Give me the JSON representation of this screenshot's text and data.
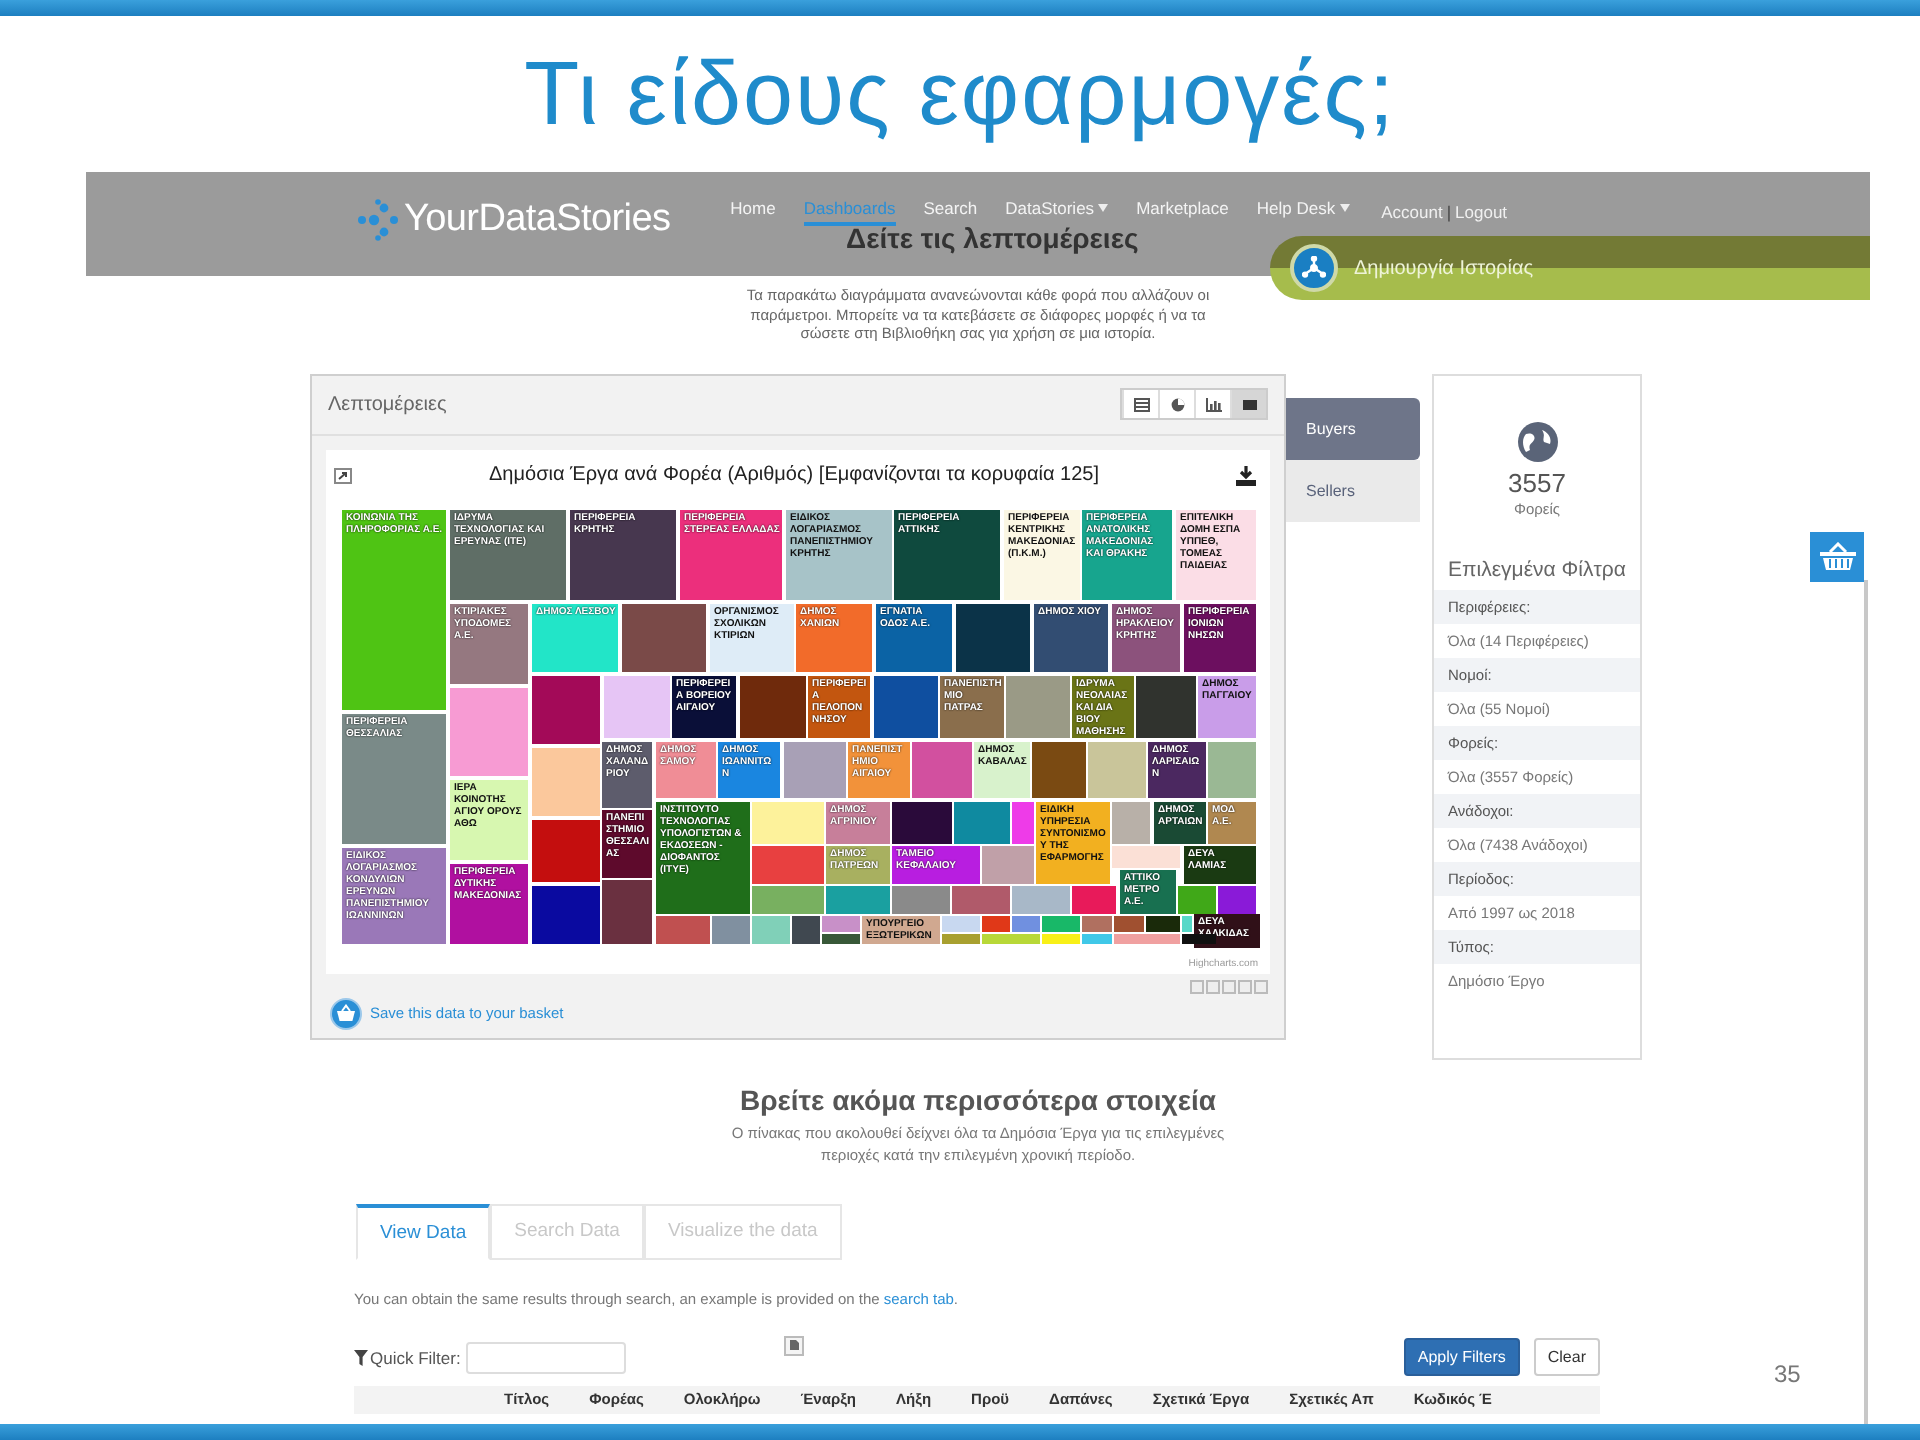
{
  "slide": {
    "title": "Τι είδους εφαρμογές;",
    "page_number": "35"
  },
  "navbar": {
    "logo": "YourDataStories",
    "items": [
      {
        "label": "Home",
        "selected": false,
        "dropdown": false
      },
      {
        "label": "Dashboards",
        "selected": true,
        "dropdown": false
      },
      {
        "label": "Search",
        "selected": false,
        "dropdown": false
      },
      {
        "label": "DataStories",
        "selected": false,
        "dropdown": true
      },
      {
        "label": "Marketplace",
        "selected": false,
        "dropdown": false
      },
      {
        "label": "Help Desk",
        "selected": false,
        "dropdown": true
      }
    ],
    "account": "Account",
    "separator": "|",
    "logout": "Logout"
  },
  "page_heading": "Δείτε τις λεπτομέρειες",
  "create_story_button": "Δημιουργία Ιστορίας",
  "intro": "Τα παρακάτω διαγράμματα ανανεώνονται κάθε φορά που αλλάζουν οι παράμετροι. Μπορείτε να τα κατεβάσετε σε διάφορες μορφές ή να τα σώσετε στη Βιβλιοθήκη σας για χρήση σε μια ιστορία.",
  "details_panel": {
    "title": "Λεπτομέρειες",
    "views": [
      {
        "kind": "table",
        "selected": false
      },
      {
        "kind": "pie",
        "selected": false
      },
      {
        "kind": "bar",
        "selected": false
      },
      {
        "kind": "treemap",
        "selected": true
      }
    ],
    "chart_title": "Δημόσια Έργα ανά Φορέα (Αριθμός) [Εμφανίζονται τα κορυφαία 125]",
    "treemap": {
      "cells": [
        {
          "label": "ΚΟΙΝΩΝΙΑ ΤΗΣ ΠΛΗΡΟΦΟΡΙΑΣ Α.Ε.",
          "color": "#4fc414"
        },
        {
          "label": "ΙΔΡΥΜΑ ΤΕΧΝΟΛΟΓΙΑΣ ΚΑΙ ΕΡΕΥΝΑΣ (ΙΤΕ)",
          "color": "#5f6e66"
        },
        {
          "label": "ΠΕΡΙΦΕΡΕΙΑ ΚΡΗΤΗΣ",
          "color": "#47374f"
        },
        {
          "label": "ΠΕΡΙΦΕΡΕΙΑ ΣΤΕΡΕΑΣ ΕΛΛΑΔΑΣ",
          "color": "#ec2f7c"
        },
        {
          "label": "ΕΙΔΙΚΟΣ ΛΟΓΑΡΙΑΣΜΟΣ ΠΑΝΕΠΙΣΤΗΜΙΟΥ ΚΡΗΤΗΣ",
          "color": "#a7c3c8"
        },
        {
          "label": "ΠΕΡΙΦΕΡΕΙΑ ΑΤΤΙΚΗΣ",
          "color": "#0f4a3e"
        },
        {
          "label": "ΠΕΡΙΦΕΡΕΙΑ ΚΕΝΤΡΙΚΗΣ ΜΑΚΕΔΟΝΙΑΣ (Π.Κ.Μ.)",
          "color": "#fbf7e4"
        },
        {
          "label": "ΠΕΡΙΦΕΡΕΙΑ ΑΝΑΤΟΛΙΚΗΣ ΜΑΚΕΔΟΝΙΑΣ ΚΑΙ ΘΡΑΚΗΣ",
          "color": "#17a58e"
        },
        {
          "label": "ΕΠΙΤΕΛΙΚΗ ΔΟΜΗ ΕΣΠΑ ΥΠΠΕΘ, ΤΟΜΕΑΣ ΠΑΙΔΕΙΑΣ",
          "color": "#fbdde6"
        },
        {
          "label": "ΚΤΙΡΙΑΚΕΣ ΥΠΟΔΟΜΕΣ Α.Ε.",
          "color": "#957880"
        },
        {
          "label": "ΔΗΜΟΣ ΛΕΣΒΟΥ",
          "color": "#22e5c8"
        },
        {
          "color": "#7a4a48"
        },
        {
          "label": "ΟΡΓΑΝΙΣΜΟΣ ΣΧΟΛΙΚΩΝ ΚΤΙΡΙΩΝ",
          "color": "#deecf7"
        },
        {
          "label": "ΔΗΜΟΣ ΧΑΝΙΩΝ",
          "color": "#f26b2a"
        },
        {
          "label": "ΕΓΝΑΤΙΑ ΟΔΟΣ Α.Ε.",
          "color": "#0b63a5"
        },
        {
          "color": "#0b3348"
        },
        {
          "label": "ΔΗΜΟΣ ΧΙΟΥ",
          "color": "#324d72"
        },
        {
          "label": "ΔΗΜΟΣ ΗΡΑΚΛΕΙΟΥ ΚΡΗΤΗΣ",
          "color": "#8c527c"
        },
        {
          "label": "ΠΕΡΙΦΕΡΕΙΑ ΙΟΝΙΩΝ ΝΗΣΩΝ",
          "color": "#6c0f5f"
        },
        {
          "color": "#a30a58"
        },
        {
          "color": "#e6c5f5"
        },
        {
          "label": "ΠΕΡΙΦΕΡΕΙΑ ΒΟΡΕΙΟΥ ΑΙΓΑΙΟΥ",
          "color": "#0a0f38"
        },
        {
          "color": "#6f2a0c"
        },
        {
          "label": "ΠΕΡΙΦΕΡΕΙΑ ΠΕΛΟΠΟΝΝΗΣΟΥ",
          "color": "#c3560f"
        },
        {
          "color": "#0f4fa0"
        },
        {
          "label": "ΠΑΝΕΠΙΣΤΗΜΙΟ ΠΑΤΡΑΣ",
          "color": "#8a6e4c"
        },
        {
          "color": "#9a9a86"
        },
        {
          "label": "ΙΔΡΥΜΑ ΝΕΟΛΑΙΑΣ ΚΑΙ ΔΙΑ ΒΙΟΥ ΜΑΘΗΣΗΣ",
          "color": "#6a7416"
        },
        {
          "color": "#30332e"
        },
        {
          "label": "ΔΗΜΟΣ ΠΑΓΓΑΙΟΥ",
          "color": "#c99de9"
        },
        {
          "color": "#f79bd3"
        },
        {
          "label": "ΠΕΡΙΦΕΡΕΙΑ ΘΕΣΣΑΛΙΑΣ",
          "color": "#7a8a88"
        },
        {
          "color": "#fbc89c"
        },
        {
          "label": "ΔΗΜΟΣ ΧΑΛΑΝΔΡΙΟΥ",
          "color": "#5d5c6c"
        },
        {
          "label": "ΔΗΜΟΣ ΣΑΜΟΥ",
          "color": "#f08d96"
        },
        {
          "label": "ΔΗΜΟΣ ΙΩΑΝΝΙΤΩΝ",
          "color": "#1a86e0"
        },
        {
          "color": "#a8a0b6"
        },
        {
          "label": "ΠΑΝΕΠΙΣΤΗΜΙΟ ΑΙΓΑΙΟΥ",
          "color": "#f2923a"
        },
        {
          "color": "#d2509f"
        },
        {
          "label": "ΔΗΜΟΣ ΚΑΒΑΛΑΣ",
          "color": "#d8f2cc"
        },
        {
          "color": "#7a4a12"
        },
        {
          "color": "#c9c59a"
        },
        {
          "label": "ΔΗΜΟΣ ΛΑΡΙΣΑΙΩΝ",
          "color": "#4b2860"
        },
        {
          "color": "#9ab894"
        },
        {
          "label": "ΙΕΡΑ ΚΟΙΝΟΤΗΣ ΑΓΙΟΥ ΟΡΟΥΣ ΑΘΩ",
          "color": "#d7f7b0"
        },
        {
          "color": "#c40e0e"
        },
        {
          "label": "ΠΑΝΕΠΙΣΤΗΜΙΟ ΘΕΣΣΑΛΙΑΣ",
          "color": "#5e0a2c"
        },
        {
          "label": "ΙΝΣΤΙΤΟΥΤΟ ΤΕΧΝΟΛΟΓΙΑΣ ΥΠΟΛΟΓΙΣΤΩΝ & ΕΚΔΟΣΕΩΝ - ΔΙΟΦΑΝΤΟΣ (ΙΤΥΕ)",
          "color": "#1f6e1a"
        },
        {
          "color": "#fdf29b"
        },
        {
          "label": "ΔΗΜΟΣ ΑΓΡΙΝΙΟΥ",
          "color": "#c77f9a"
        },
        {
          "color": "#2a0a3a"
        },
        {
          "color": "#0f8aa0"
        },
        {
          "color": "#ee3be8"
        },
        {
          "label": "ΕΙΔΙΚΗ ΥΠΗΡΕΣΙΑ ΣΥΝΤΟΝΙΣΜΟΥ ΤΗΣ ΕΦΑΡΜΟΓΗΣ",
          "color": "#f2b020"
        },
        {
          "color": "#b8b0a8"
        },
        {
          "label": "ΔΗΜΟΣ ΑΡΤΑΙΩΝ",
          "color": "#1a4a34"
        },
        {
          "label": "ΜΟΔ Α.Ε.",
          "color": "#b08850"
        },
        {
          "color": "#e84040"
        },
        {
          "label": "ΔΗΜΟΣ ΠΑΤΡΕΩΝ",
          "color": "#a8b060"
        },
        {
          "label": "ΤΑΜΕΙΟ ΚΕΦΑΛΑΙΟΥ",
          "color": "#b81ee0"
        },
        {
          "color": "#c0a0a8"
        },
        {
          "color": "#fbe0d6"
        },
        {
          "label": "ΔΕΥΑ ΛΑΜΙΑΣ",
          "color": "#1a3a12"
        },
        {
          "color": "#78b060"
        },
        {
          "color": "#1aa0a0"
        },
        {
          "color": "#8a8a8a"
        },
        {
          "color": "#b05a6a"
        },
        {
          "color": "#a8b8c8"
        },
        {
          "color": "#e81a5a"
        },
        {
          "label": "ΑΤΤΙΚΟ ΜΕΤΡΟ Α.Ε.",
          "color": "#187050"
        },
        {
          "color": "#40a818"
        },
        {
          "color": "#8a1ad8"
        },
        {
          "color": "#c05050"
        },
        {
          "color": "#8090a0"
        },
        {
          "color": "#80d0b8"
        },
        {
          "color": "#404850"
        },
        {
          "color": "#c890c8"
        },
        {
          "label": "ΥΠΟΥΡΓΕΙΟ ΕΞΩΤΕΡΙΚΩΝ",
          "color": "#d0a890"
        },
        {
          "color": "#c8d8f0"
        },
        {
          "color": "#e03818"
        },
        {
          "color": "#7090e0"
        },
        {
          "color": "#18b868"
        },
        {
          "color": "#b07060"
        },
        {
          "color": "#a05030"
        },
        {
          "color": "#1a2a0a"
        },
        {
          "color": "#58d8c8"
        },
        {
          "label": "ΔΕΥΑ ΧΑΛΚΙΔΑΣ",
          "color": "#301018"
        },
        {
          "label": "ΕΙΔΙΚΟΣ ΛΟΓΑΡΙΑΣΜΟΣ ΚΟΝΔΥΛΙΩΝ ΕΡΕΥΝΩΝ ΠΑΝΕΠΙΣΤΗΜΙΟΥ ΙΩΑΝΝΙΝΩΝ",
          "color": "#9a78b8"
        },
        {
          "label": "ΠΕΡΙΦΕΡΕΙΑ ΔΥΤΙΚΗΣ ΜΑΚΕΔΟΝΙΑΣ",
          "color": "#b010a0"
        },
        {
          "color": "#0a0aa0"
        },
        {
          "color": "#6a3040"
        },
        {
          "color": "#385838"
        },
        {
          "color": "#a8a030"
        },
        {
          "color": "#b8d838"
        },
        {
          "color": "#f8f018"
        },
        {
          "color": "#40c8e8"
        },
        {
          "color": "#f0a0a0"
        },
        {
          "color": "#101010"
        }
      ]
    },
    "credit": "Highcharts.com",
    "save_link": "Save this data to your basket"
  },
  "side_tabs": [
    {
      "label": "Buyers",
      "selected": true
    },
    {
      "label": "Sellers",
      "selected": false
    }
  ],
  "summary": {
    "count": "3557",
    "count_label": "Φορείς",
    "filters_title": "Επιλεγμένα Φίλτρα",
    "filters": [
      {
        "label": "Περιφέρειες:",
        "value": "Όλα (14 Περιφέρειες)"
      },
      {
        "label": "Νομοί:",
        "value": "Όλα (55 Νομοί)"
      },
      {
        "label": "Φορείς:",
        "value": "Όλα (3557 Φορείς)"
      },
      {
        "label": "Ανάδοχοι:",
        "value": "Όλα (7438 Ανάδοχοι)"
      },
      {
        "label": "Περίοδος:",
        "value": "Από 1997 ως 2018"
      },
      {
        "label": "Τύπος:",
        "value": "Δημόσιο Έργο"
      }
    ]
  },
  "more_section": {
    "heading": "Βρείτε ακόμα περισσότερα στοιχεία",
    "text": "Ο πίνακας που ακολουθεί δείχνει όλα τα Δημόσια Έργα για τις επιλεγμένες περιοχές κατά την επιλεγμένη χρονική περίοδο.",
    "tabs": [
      {
        "label": "View Data",
        "selected": true
      },
      {
        "label": "Search Data",
        "selected": false
      },
      {
        "label": "Visualize the data",
        "selected": false
      }
    ],
    "hint": {
      "text": "You can obtain the same results through search, an example is provided on the ",
      "link": "search tab",
      "end": "."
    },
    "quick_filter": {
      "label": "Quick Filter:"
    },
    "buttons": [
      {
        "label": "Apply Filters",
        "kind": "primary"
      },
      {
        "label": "Clear",
        "kind": "default"
      }
    ],
    "table": {
      "columns": [
        "Τίτλος",
        "Φορέας",
        "Ολοκλήρω",
        "Έναρξη",
        "Λήξη",
        "Προϋ",
        "Δαπάνες",
        "Σχετικά Έργα",
        "Σχετικές Απ",
        "Κωδικός Έ"
      ]
    }
  }
}
